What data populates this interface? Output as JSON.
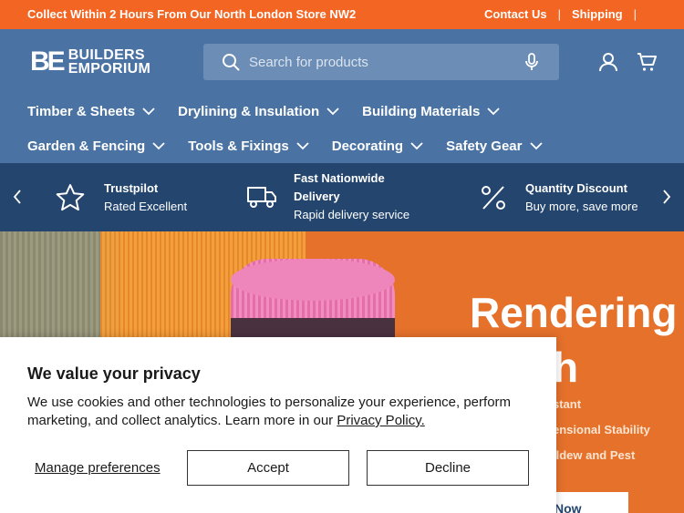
{
  "announcement": {
    "promo": "Collect Within 2 Hours From Our North London Store NW2",
    "links": [
      "Contact Us",
      "Shipping"
    ]
  },
  "header": {
    "logo_mark": "BE",
    "logo_line1": "BUILDERS",
    "logo_line2": "EMPORIUM",
    "search_placeholder": "Search for products",
    "icons": [
      "search-icon",
      "microphone-icon",
      "account-icon",
      "cart-icon"
    ]
  },
  "nav": {
    "row1": [
      "Timber & Sheets",
      "Drylining & Insulation",
      "Building Materials"
    ],
    "row2": [
      "Garden & Fencing",
      "Tools & Fixings",
      "Decorating",
      "Safety Gear"
    ]
  },
  "usp": [
    {
      "icon": "star-icon",
      "title": "Trustpilot",
      "subtitle": "Rated Excellent"
    },
    {
      "icon": "truck-icon",
      "title_line1": "Fast Nationwide",
      "title_line2": "Delivery",
      "subtitle": "Rapid delivery service"
    },
    {
      "icon": "percent-icon",
      "title": "Quantity Discount",
      "subtitle": "Buy more, save more"
    }
  ],
  "hero": {
    "title": "Rendering",
    "line2": "h",
    "features": [
      "stant",
      "ensional Stability",
      "ildew and Pest"
    ],
    "button": "Now"
  },
  "cookie": {
    "title": "We value your privacy",
    "body": "We use cookies and other technologies to personalize your experience, perform marketing, and collect analytics. Learn more in our",
    "policy_link": "Privacy Policy.",
    "manage": "Manage preferences",
    "accept": "Accept",
    "decline": "Decline"
  },
  "colors": {
    "announcement_bg": "#f26522",
    "header_bg": "#4a73a4",
    "usp_bg": "#23456e",
    "hero_bg": "#e5712b"
  }
}
